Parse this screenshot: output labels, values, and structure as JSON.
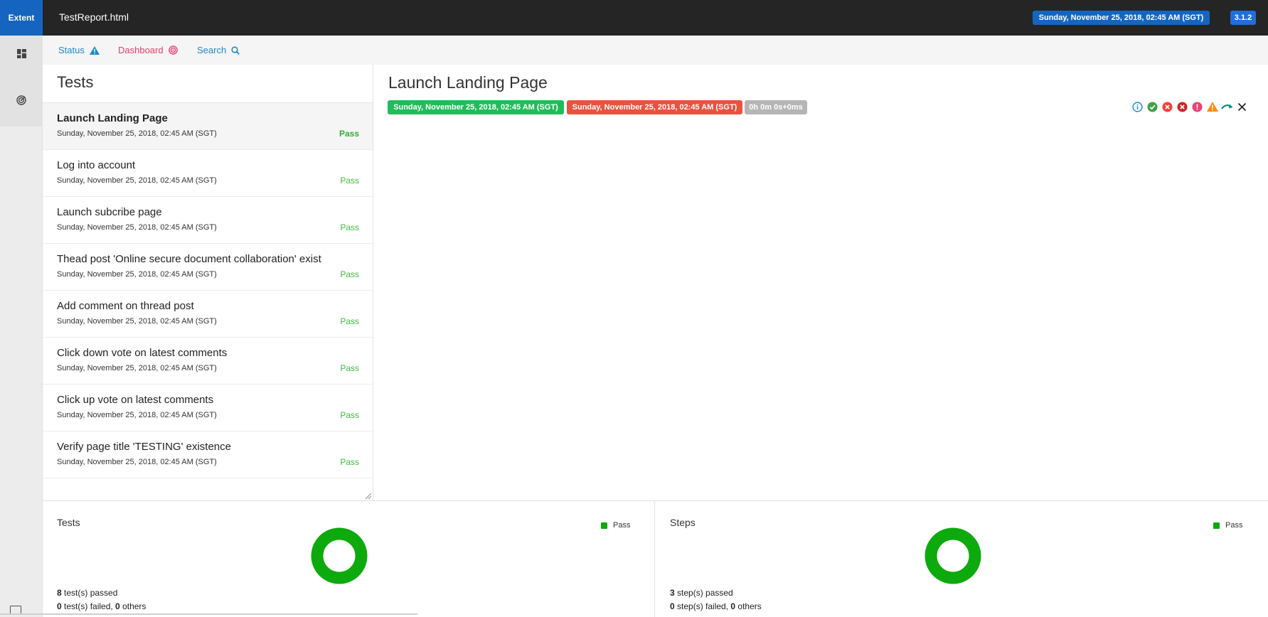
{
  "header": {
    "brand": "Extent",
    "report_name": "TestReport.html",
    "date": "Sunday, November 25, 2018, 02:45 AM (SGT)",
    "version": "3.1.2"
  },
  "rail": {
    "icons": [
      "dashboard-grid-icon",
      "radar-icon",
      "window-icon"
    ]
  },
  "nav": {
    "status": "Status",
    "dashboard": "Dashboard",
    "search": "Search"
  },
  "tests_panel": {
    "title": "Tests",
    "items": [
      {
        "name": "Launch Landing Page",
        "time": "Sunday, November 25, 2018, 02:45 AM (SGT)",
        "status": "Pass"
      },
      {
        "name": "Log into account",
        "time": "Sunday, November 25, 2018, 02:45 AM (SGT)",
        "status": "Pass"
      },
      {
        "name": "Launch subcribe page",
        "time": "Sunday, November 25, 2018, 02:45 AM (SGT)",
        "status": "Pass"
      },
      {
        "name": "Thead post 'Online secure document collaboration' exist",
        "time": "Sunday, November 25, 2018, 02:45 AM (SGT)",
        "status": "Pass"
      },
      {
        "name": "Add comment on thread post",
        "time": "Sunday, November 25, 2018, 02:45 AM (SGT)",
        "status": "Pass"
      },
      {
        "name": "Click down vote on latest comments",
        "time": "Sunday, November 25, 2018, 02:45 AM (SGT)",
        "status": "Pass"
      },
      {
        "name": "Click up vote on latest comments",
        "time": "Sunday, November 25, 2018, 02:45 AM (SGT)",
        "status": "Pass"
      },
      {
        "name": "Verify page title 'TESTING' existence",
        "time": "Sunday, November 25, 2018, 02:45 AM (SGT)",
        "status": "Pass"
      }
    ]
  },
  "detail": {
    "title": "Launch Landing Page",
    "start_time": "Sunday, November 25, 2018, 02:45 AM (SGT)",
    "end_time": "Sunday, November 25, 2018, 02:45 AM (SGT)",
    "duration": "0h 0m 0s+0ms",
    "filter_icons": [
      "info-icon",
      "pass-check-icon",
      "fail-icon",
      "fatal-icon",
      "error-icon",
      "warning-icon",
      "skip-icon",
      "clear-filter-icon"
    ]
  },
  "dashboard": {
    "tests": {
      "title": "Tests",
      "legend": "Pass",
      "passed_count": "8",
      "passed_label": " test(s) passed",
      "failed_count": "0",
      "failed_label": " test(s) failed, ",
      "others_count": "0",
      "others_label": " others"
    },
    "steps": {
      "title": "Steps",
      "legend": "Pass",
      "passed_count": "3",
      "passed_label": " step(s) passed",
      "failed_count": "0",
      "failed_label": " step(s) failed, ",
      "others_count": "0",
      "others_label": " others"
    }
  },
  "colors": {
    "brand": "#1565c0",
    "pass": "#0caa0c",
    "fail": "#e8523f",
    "status_nav": "#1e88c7",
    "dashboard_nav": "#e53d6d"
  }
}
